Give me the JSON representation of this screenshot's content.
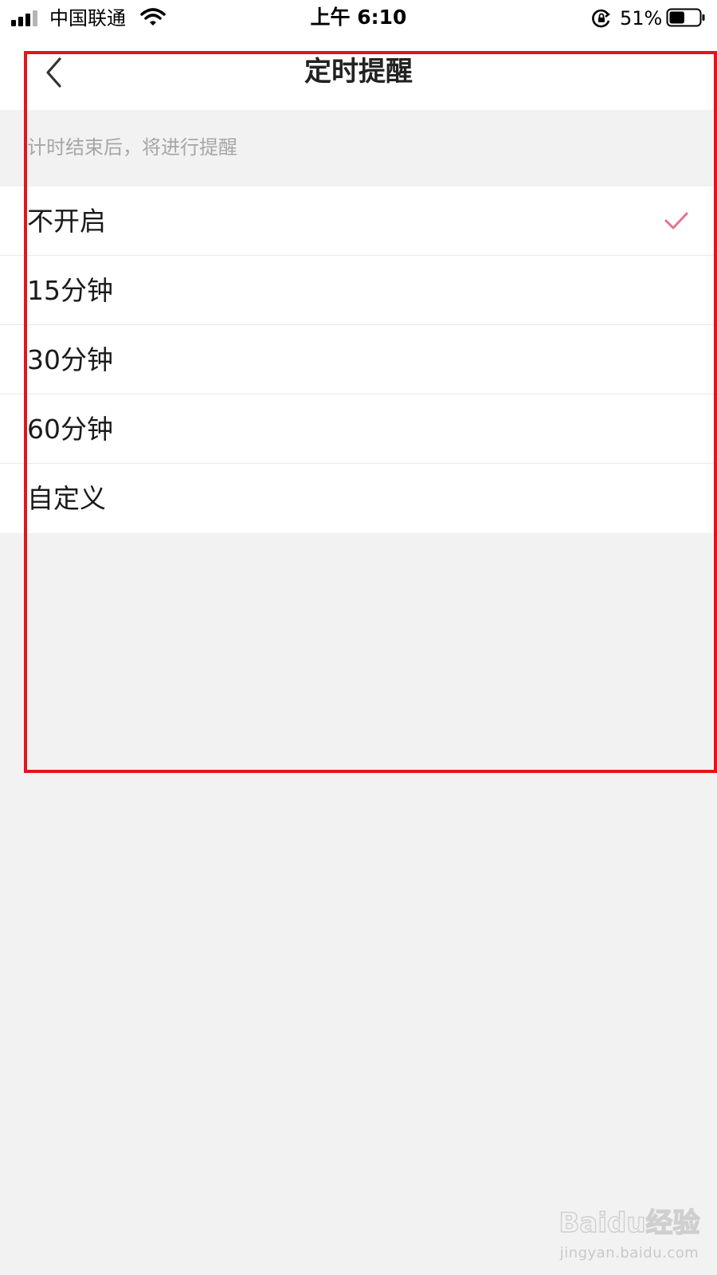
{
  "status_bar": {
    "carrier": "中国联通",
    "time": "上午 6:10",
    "battery_percent": "51%",
    "battery_level": 0.51
  },
  "nav": {
    "title": "定时提醒",
    "back_icon": "chevron-left-icon"
  },
  "section": {
    "hint": "计时结束后，将进行提醒"
  },
  "options": [
    {
      "label": "不开启",
      "selected": true
    },
    {
      "label": "15分钟",
      "selected": false
    },
    {
      "label": "30分钟",
      "selected": false
    },
    {
      "label": "60分钟",
      "selected": false
    },
    {
      "label": "自定义",
      "selected": false
    }
  ],
  "colors": {
    "accent_check": "#e8718d",
    "annotation_frame": "#e3141b",
    "page_background": "#f2f2f2"
  },
  "watermark": {
    "logo_text": "Baidu经验",
    "url": "jingyan.baidu.com"
  }
}
